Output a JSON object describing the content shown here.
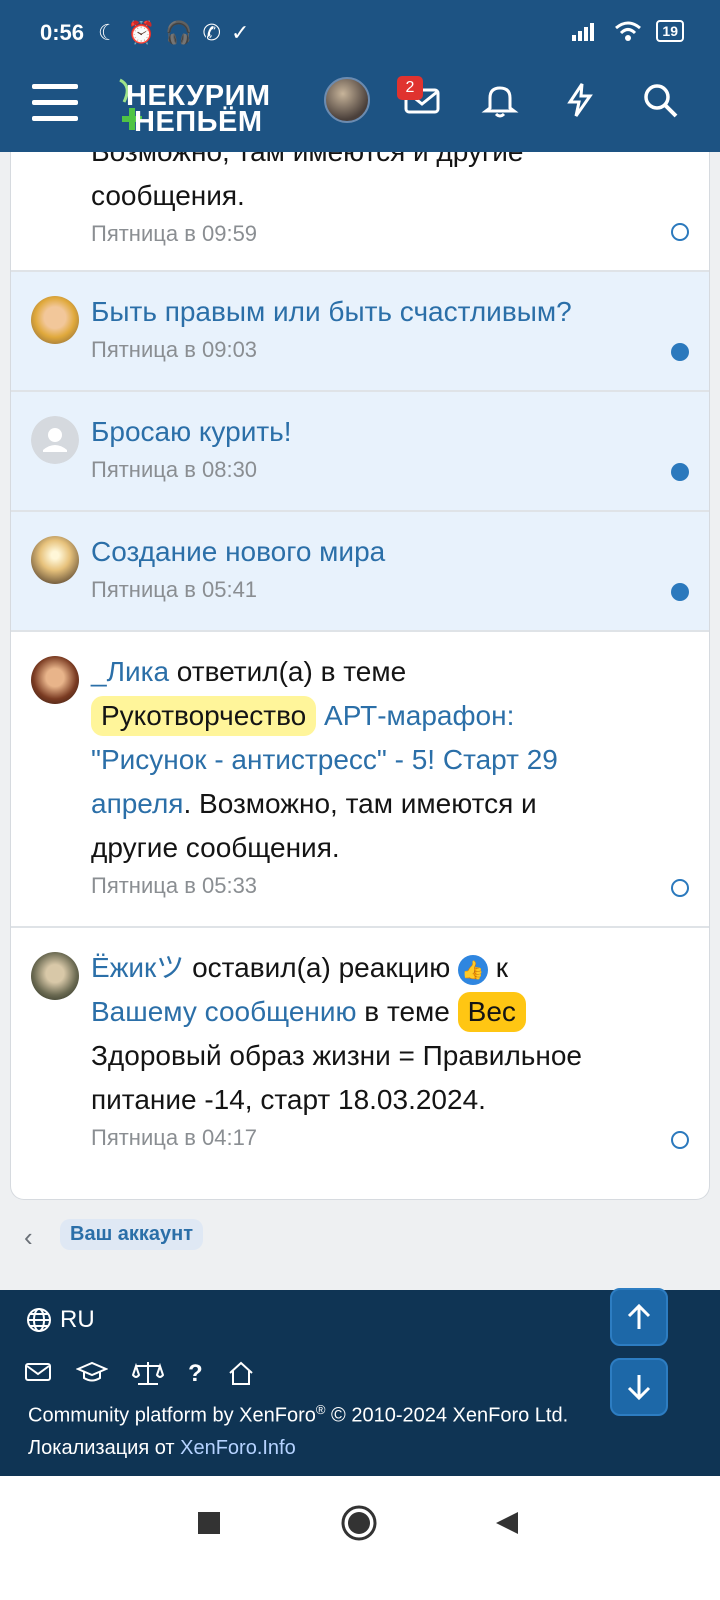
{
  "status_bar": {
    "time": "0:56",
    "battery": "19"
  },
  "header": {
    "logo_line1": "НЕКУРИМ",
    "logo_line2": "НЕПЬЁМ",
    "messages_badge": "2"
  },
  "items": [
    {
      "partial_text_top": "Возможно, там имеются и другие",
      "text": "сообщения.",
      "time": "Пятница в 09:59",
      "unread": false
    },
    {
      "title": "Быть правым или быть счастливым?",
      "time": "Пятница в 09:03",
      "unread": true
    },
    {
      "title": "Бросаю курить!",
      "time": "Пятница в 08:30",
      "unread": true
    },
    {
      "title": "Создание нового мира",
      "time": "Пятница в 05:41",
      "unread": true
    },
    {
      "user": "_Лика",
      "action": " ответил(а) в теме",
      "prefix": "Рукотворчество",
      "thread_part1": "АРТ-марафон:",
      "thread_part2": "\"Рисунок - антистресс\" - 5! Старт 29",
      "thread_part3": "апреля",
      "tail_part1": ". Возможно, там имеются и",
      "tail_part2": "другие сообщения.",
      "time": "Пятница в 05:33",
      "unread": false
    },
    {
      "user": "Ёжикツ",
      "action": " оставил(а) реакцию",
      "to": " к",
      "message_link": "Вашему сообщению",
      "in_thread": " в теме ",
      "prefix": "Вес",
      "thread_part1": "Здоровый образ жизни = Правильное",
      "thread_part2": "питание -14, старт 18.03.2024.",
      "time": "Пятница в 04:17",
      "unread": false
    }
  ],
  "breadcrumb": {
    "label": "Ваш аккаунт"
  },
  "footer": {
    "lang": "RU",
    "copyright_1": "Community platform by XenForo",
    "registered": "®",
    "copyright_2": " © 2010-2024 XenForo Ltd.",
    "localization": "Локализация от ",
    "localization_link": "XenForo.Info"
  },
  "colors": {
    "header": "#1d5383",
    "link": "#2b6fa8",
    "unread_bg": "#e8f2fc",
    "footer": "#0f3454"
  },
  "icons": [
    "menu-icon",
    "mail-icon",
    "bell-icon",
    "bolt-icon",
    "search-icon",
    "globe-icon",
    "scroll-up-icon",
    "scroll-down-icon"
  ]
}
